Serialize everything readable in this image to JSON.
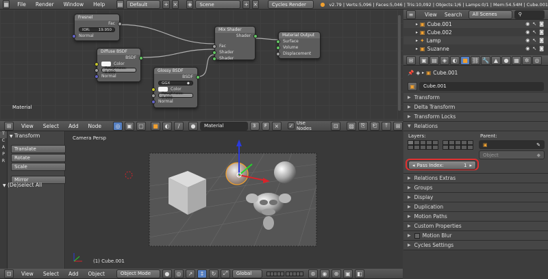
{
  "info_header": {
    "menus": [
      "File",
      "Render",
      "Window",
      "Help"
    ],
    "layout": "Default",
    "scene": "Scene",
    "engine": "Cycles Render",
    "stats": "v2.79 | Verts:5,096 | Faces:5,046 | Tris:10,092 | Objects:1/6 | Lamps:0/1 | Mem:54.54M | Cube.001"
  },
  "node_editor": {
    "label": "Material",
    "nodes": {
      "fresnel": {
        "title": "Fresnel",
        "out": "Fac",
        "ior_label": "IOR:",
        "ior_value": "19.950",
        "normal": "Normal"
      },
      "diffuse": {
        "title": "Diffuse BSDF",
        "out": "BSDF",
        "color": "Color",
        "roughness": "Roughness: 0.000",
        "normal": "Normal"
      },
      "glossy": {
        "title": "Glossy BSDF",
        "out": "BSDF",
        "dist": "GGX",
        "color": "Color",
        "roughness": "Roughness: 0.000",
        "normal": "Normal"
      },
      "mix": {
        "title": "Mix Shader",
        "out": "Shader",
        "fac": "Fac",
        "shader1": "Shader",
        "shader2": "Shader"
      },
      "output": {
        "title": "Material Output",
        "surface": "Surface",
        "volume": "Volume",
        "displacement": "Displacement"
      }
    },
    "header": {
      "menus": [
        "View",
        "Select",
        "Add",
        "Node"
      ],
      "material": "Material",
      "users": "3",
      "fake": "F",
      "use_nodes": "Use Nodes"
    }
  },
  "tool_shelf": {
    "tabs": [
      "T",
      "C",
      "A",
      "P",
      "R"
    ],
    "section": "Transform",
    "buttons": [
      "Translate",
      "Rotate",
      "Scale"
    ],
    "mirror": "Mirror",
    "deselect": "(De)select All"
  },
  "viewport": {
    "label": "Camera Persp",
    "object": "(1) Cube.001",
    "header": {
      "menus": [
        "View",
        "Select",
        "Add",
        "Object"
      ],
      "mode": "Object Mode",
      "orientation": "Global"
    }
  },
  "outliner": {
    "menus": [
      "View",
      "Search"
    ],
    "filter": "All Scenes",
    "items": [
      "Cube.001",
      "Cube.002",
      "Lamp",
      "Suzanne"
    ]
  },
  "properties": {
    "breadcrumb": "Cube.001",
    "object_name": "Cube.001",
    "panels_top": [
      "Transform",
      "Delta Transform",
      "Transform Locks"
    ],
    "relations": {
      "title": "Relations",
      "layers": "Layers:",
      "parent": "Parent:",
      "parent_type": "Object",
      "pass_index_label": "Pass Index:",
      "pass_index_value": "1"
    },
    "panels_bottom": [
      "Relations Extras",
      "Groups",
      "Display",
      "Duplication",
      "Motion Paths",
      "Custom Properties",
      "Motion Blur",
      "Cycles Settings"
    ]
  },
  "colors": {
    "highlight": "#e23030",
    "selected": "#5680c2",
    "orange": "#f0a030"
  }
}
